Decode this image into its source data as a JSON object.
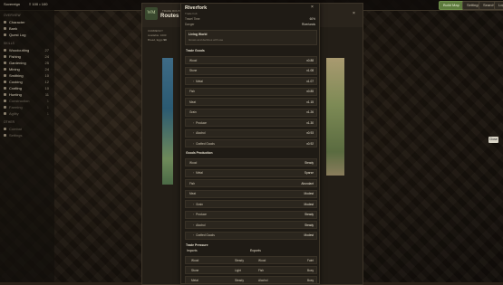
{
  "topbar": {
    "brand": "Sovereign",
    "stats": "≡ 100 • 100",
    "buttons": [
      "Build Map",
      "Settings",
      "Search",
      "Log"
    ]
  },
  "sidebar": {
    "sections": [
      {
        "title": "OVERVIEW",
        "items": [
          {
            "label": "Character",
            "level": "",
            "dim": false
          },
          {
            "label": "Bank",
            "level": "",
            "dim": false
          },
          {
            "label": "Quest Log",
            "level": "",
            "dim": false
          }
        ]
      },
      {
        "title": "SKILLS",
        "items": [
          {
            "label": "Woodcutting",
            "level": "27",
            "dim": false
          },
          {
            "label": "Fishing",
            "level": "24",
            "dim": false
          },
          {
            "label": "Gardening",
            "level": "25",
            "dim": false
          },
          {
            "label": "Mining",
            "level": "24",
            "dim": false
          },
          {
            "label": "Smithing",
            "level": "10",
            "dim": false
          },
          {
            "label": "Cooking",
            "level": "12",
            "dim": false
          },
          {
            "label": "Crafting",
            "level": "10",
            "dim": false
          },
          {
            "label": "Hunting",
            "level": "11",
            "dim": false
          },
          {
            "label": "Construction",
            "level": "1",
            "dim": true
          },
          {
            "label": "Farming",
            "level": "1",
            "dim": true
          },
          {
            "label": "Agility",
            "level": "1",
            "dim": true
          }
        ]
      },
      {
        "title": "OTHER",
        "items": [
          {
            "label": "Combat",
            "level": "",
            "dim": true
          },
          {
            "label": "Settings",
            "level": "",
            "dim": true
          }
        ]
      }
    ]
  },
  "route": {
    "logo": "WM",
    "small": "TRADE ROUTES",
    "title": "Routes &",
    "meta": [
      "CURRENCY",
      "Available: 1000",
      "Bread, Eggs"
    ],
    "meta_values": [
      "",
      "",
      "90"
    ],
    "close": "×",
    "map_close": "Close"
  },
  "modal": {
    "title": "Riverfork",
    "subtitle": "Trade hub",
    "close": "×",
    "info": [
      {
        "label": "Travel Time",
        "value": "60%"
      },
      {
        "label": "Danger",
        "value": "Riverlands"
      }
    ],
    "world": {
      "label": "Living World",
      "value": "Grows and declines with use"
    },
    "sections": {
      "trade_goods": "Trade Goods",
      "goods_production": "Goods Production",
      "trade_pressure": "Trade Pressure"
    },
    "trade_goods": [
      {
        "name": "Wood",
        "value": "x0.88",
        "sub": false
      },
      {
        "name": "Stone",
        "value": "x1.08",
        "sub": false
      },
      {
        "name": "Metal",
        "value": "x1.07",
        "sub": true
      },
      {
        "name": "Fish",
        "value": "x0.85",
        "sub": false
      },
      {
        "name": "Meat",
        "value": "x1.15",
        "sub": false
      },
      {
        "name": "Grain",
        "value": "x1.26",
        "sub": false
      },
      {
        "name": "Produce",
        "value": "x1.30",
        "sub": true
      },
      {
        "name": "Alcohol",
        "value": "x0.93",
        "sub": true
      },
      {
        "name": "Crafted Goods",
        "value": "x0.92",
        "sub": true
      }
    ],
    "production": [
      {
        "name": "Wood",
        "value": "Steady",
        "sub": false
      },
      {
        "name": "Metal",
        "value": "Sparse",
        "sub": true
      },
      {
        "name": "Fish",
        "value": "Abundant",
        "sub": false
      },
      {
        "name": "Meat",
        "value": "Modest",
        "sub": false
      },
      {
        "name": "Grain",
        "value": "Modest",
        "sub": true
      },
      {
        "name": "Produce",
        "value": "Steady",
        "sub": true
      },
      {
        "name": "Alcohol",
        "value": "Steady",
        "sub": true
      },
      {
        "name": "Crafted Goods",
        "value": "Modest",
        "sub": true
      }
    ],
    "pressure": {
      "imports": "Imports",
      "exports": "Exports",
      "rows": [
        {
          "import": "Wood",
          "import_level": "Steady",
          "export": "Wood",
          "export_level": "Faint"
        },
        {
          "import": "Stone",
          "import_level": "Light",
          "export": "Fish",
          "export_level": "Busy"
        },
        {
          "import": "Metal",
          "import_level": "Steady",
          "export": "Alcohol",
          "export_level": "Busy"
        }
      ]
    }
  }
}
